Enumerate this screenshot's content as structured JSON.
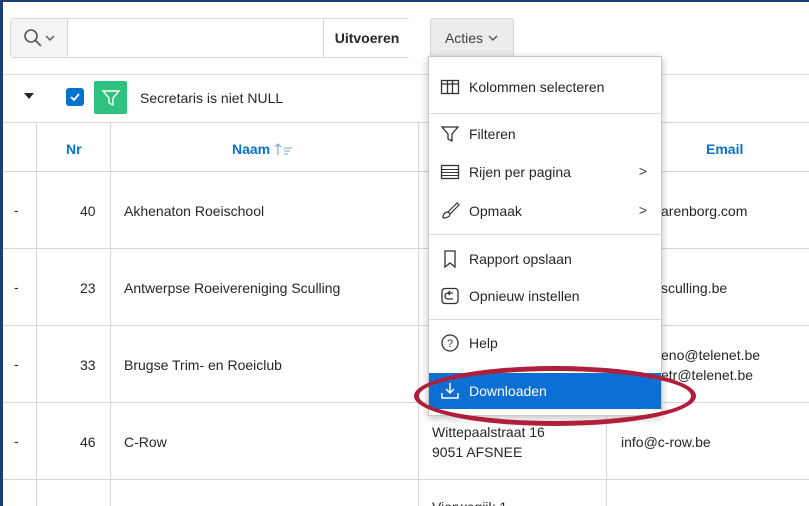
{
  "toolbar": {
    "go_label": "Uitvoeren",
    "actions_label": "Acties"
  },
  "filter": {
    "text": "Secretaris is niet NULL"
  },
  "table": {
    "columns": [
      "Nr",
      "Naam",
      "Email"
    ],
    "rows": [
      {
        "dash": "-",
        "nr": "40",
        "naam": "Akhenaton Roeischool",
        "adres": [
          "",
          ""
        ],
        "email": [
          "arenborg.com",
          ""
        ]
      },
      {
        "dash": "-",
        "nr": "23",
        "naam": "Antwerpse Roeivereniging Sculling",
        "adres": [
          "",
          ""
        ],
        "email": [
          "sculling.be",
          ""
        ]
      },
      {
        "dash": "-",
        "nr": "33",
        "naam": "Brugse Trim- en Roeiclub",
        "adres": [
          "",
          ""
        ],
        "email": [
          "eno@telenet.be",
          "etr@telenet.be"
        ]
      },
      {
        "dash": "-",
        "nr": "46",
        "naam": "C-Row",
        "adres": [
          "Wittepaalstraat 16",
          "9051 AFSNEE"
        ],
        "email": [
          "info@c-row.be",
          ""
        ]
      },
      {
        "dash": "",
        "nr": "",
        "naam": "",
        "adres": [
          "Vierwegijk 1",
          ""
        ],
        "email": [
          "",
          ""
        ]
      }
    ]
  },
  "menu": {
    "items": [
      {
        "label": "Kolommen selecteren",
        "icon": "columns-icon"
      },
      {
        "label": "Filteren",
        "icon": "filter-icon"
      },
      {
        "label": "Rijen per pagina",
        "icon": "rows-icon",
        "submenu": ">"
      },
      {
        "label": "Opmaak",
        "icon": "brush-icon",
        "submenu": ">"
      },
      {
        "label": "Rapport opslaan",
        "icon": "bookmark-icon"
      },
      {
        "label": "Opnieuw instellen",
        "icon": "reset-icon"
      },
      {
        "label": "Help",
        "icon": "help-icon"
      },
      {
        "label": "Downloaden",
        "icon": "download-icon"
      }
    ]
  },
  "colors": {
    "accent": "#0572ce",
    "menu_highlight": "#0b6fd3",
    "filter_badge": "#2ec27e",
    "ring": "#b01e3c"
  }
}
